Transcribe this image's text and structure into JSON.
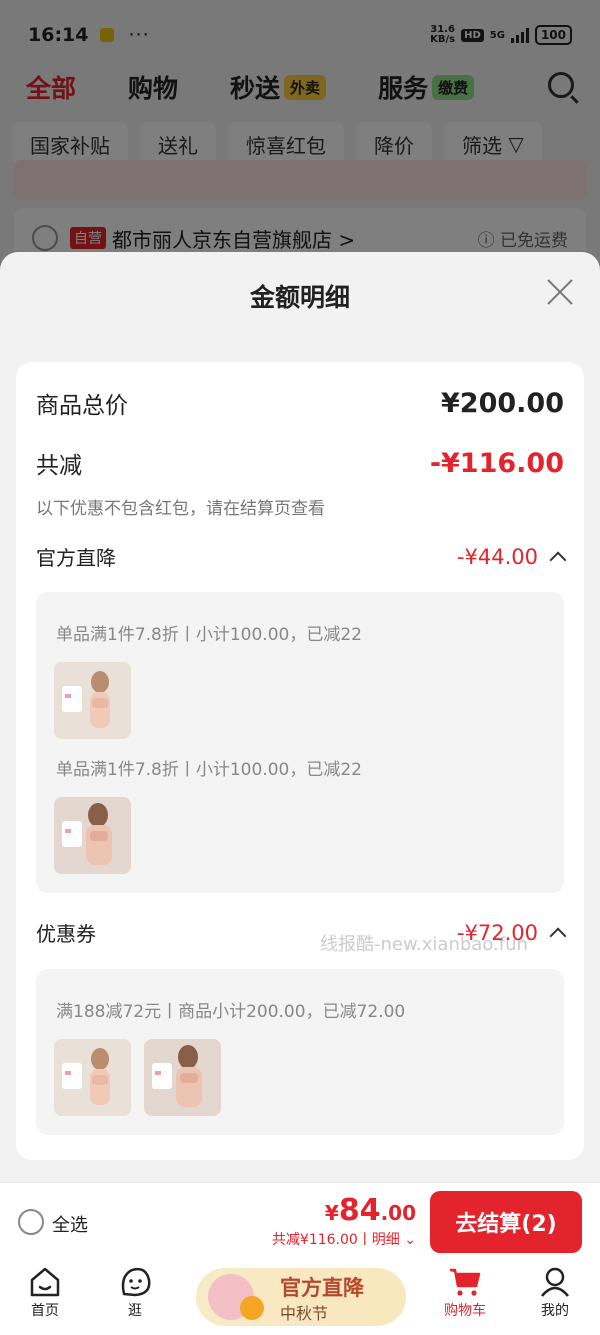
{
  "status_bar": {
    "time": "16:14",
    "dots": "···",
    "net_speed_top": "31.6",
    "net_speed_bottom": "KB/s",
    "hd": "HD",
    "signal": "5G",
    "battery": "100"
  },
  "top_nav": {
    "tabs": [
      {
        "label": "全部",
        "active": true
      },
      {
        "label": "购物",
        "active": false
      },
      {
        "label": "秒送",
        "tag": "外卖",
        "active": false
      },
      {
        "label": "服务",
        "tag": "缴费",
        "active": false
      }
    ]
  },
  "filters": [
    "国家补贴",
    "送礼",
    "惊喜红包",
    "降价",
    "筛选"
  ],
  "background_shop": {
    "self_tag": "自营",
    "name": "都市丽人京东自营旗舰店 >",
    "shipping": "ⓘ 已免运费"
  },
  "sheet": {
    "title": "金额明细",
    "total_label": "商品总价",
    "total_value": "¥200.00",
    "reduce_label": "共减",
    "reduce_value": "-¥116.00",
    "note": "以下优惠不包含红包，请在结算页查看",
    "sections": [
      {
        "label": "官方直降",
        "value": "-¥44.00",
        "lines": [
          "单品满1件7.8折丨小计100.00，已减22",
          "单品满1件7.8折丨小计100.00，已减22"
        ]
      },
      {
        "label": "优惠券",
        "value": "-¥72.00",
        "lines": [
          "满188减72元丨商品小计200.00，已减72.00"
        ]
      }
    ],
    "watermark": "线报酷-new.xianbao.fun"
  },
  "checkout": {
    "select_all": "全选",
    "price_yen": "¥",
    "price_int": "84",
    "price_dec": ".00",
    "reduce_text": "共减¥116.00丨明细",
    "pay_button": "去结算(2)"
  },
  "tabbar": {
    "items": [
      {
        "label": "首页"
      },
      {
        "label": "逛"
      },
      {
        "label": "购物车",
        "active": true
      },
      {
        "label": "我的"
      }
    ],
    "promo_title": "官方直降",
    "promo_sub": "中秋节"
  },
  "colors": {
    "accent": "#e4242d",
    "sheet_bg": "#f2f2f2",
    "card_bg": "#ffffff"
  }
}
